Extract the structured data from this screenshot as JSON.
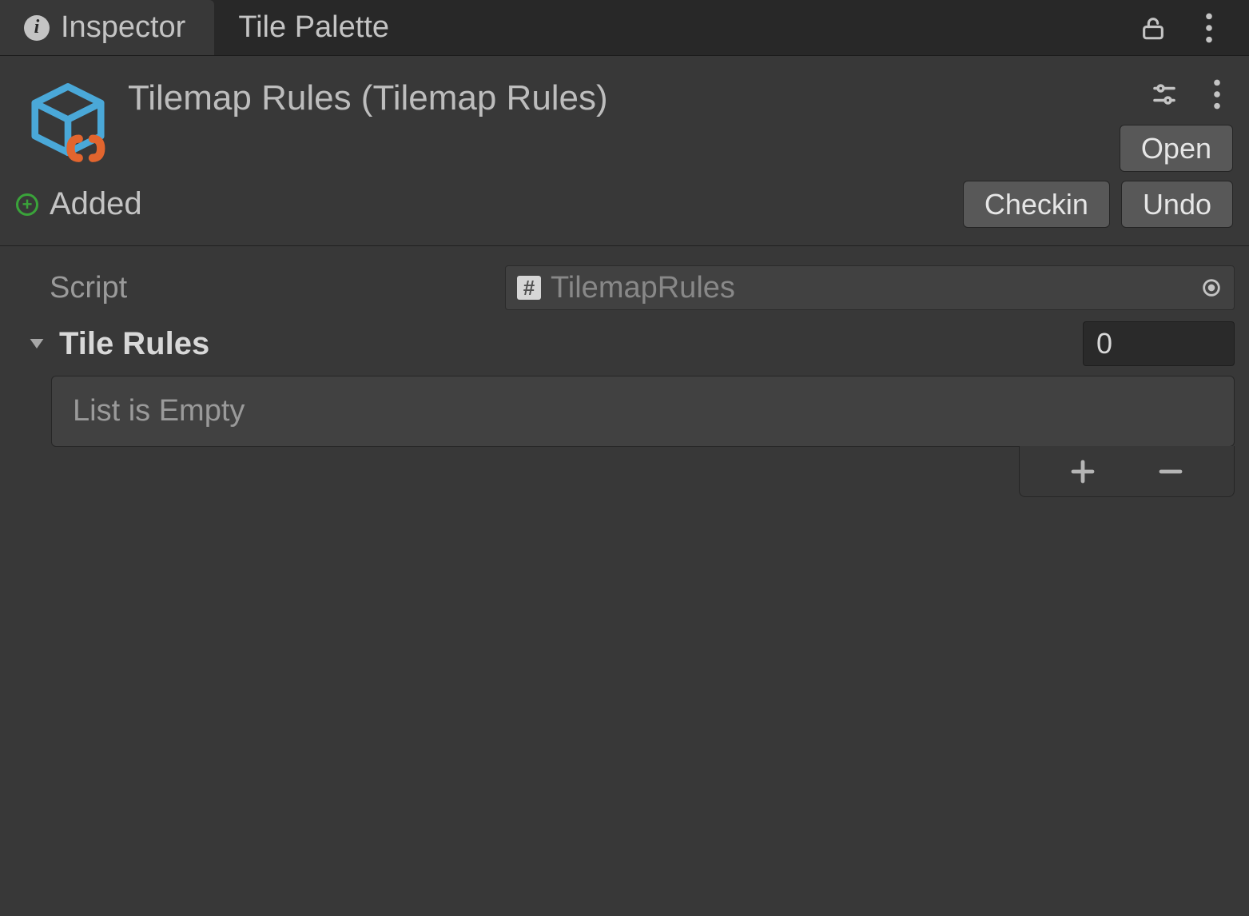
{
  "tabs": {
    "inspector": "Inspector",
    "tile_palette": "Tile Palette"
  },
  "asset": {
    "title": "Tilemap Rules (Tilemap Rules)",
    "open_label": "Open"
  },
  "vcs": {
    "status_label": "Added",
    "checkin_label": "Checkin",
    "undo_label": "Undo"
  },
  "script": {
    "label": "Script",
    "value": "TilemapRules"
  },
  "tile_rules": {
    "label": "Tile Rules",
    "count": "0",
    "empty_text": "List is Empty"
  }
}
